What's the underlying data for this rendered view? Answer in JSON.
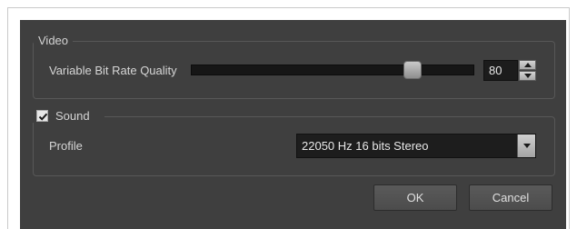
{
  "video": {
    "group_title": "Video",
    "quality_label": "Variable Bit Rate Quality",
    "quality_value": "80",
    "quality_slider_fraction": 0.8
  },
  "sound": {
    "group_title": "Sound",
    "enabled": true,
    "profile_label": "Profile",
    "profile_value": "22050 Hz 16 bits Stereo"
  },
  "buttons": {
    "ok": "OK",
    "cancel": "Cancel"
  },
  "icons": {
    "spin_up": "arrow-up-icon",
    "spin_down": "arrow-down-icon",
    "combo_arrow": "chevron-down-icon",
    "checkbox": "checkmark-icon"
  },
  "colors": {
    "dialog_bg": "#3f3f3f",
    "field_bg": "#1d1d1d",
    "button_bg": "#555555"
  }
}
